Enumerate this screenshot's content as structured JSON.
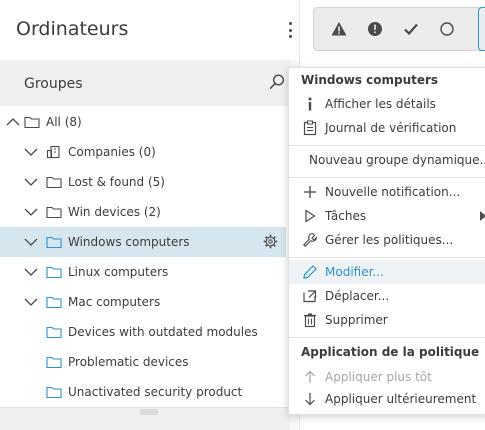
{
  "header": {
    "title": "Ordinateurs"
  },
  "groups": {
    "label": "Groupes",
    "tree": [
      {
        "label": "All (8)",
        "icon": "folder-icon"
      },
      {
        "label": "Companies (0)",
        "icon": "company-icon"
      },
      {
        "label": "Lost & found (5)",
        "icon": "folder-icon"
      },
      {
        "label": "Win devices (2)",
        "icon": "folder-icon"
      },
      {
        "label": "Windows computers",
        "icon": "folder-icon"
      },
      {
        "label": "Linux computers",
        "icon": "folder-icon"
      },
      {
        "label": "Mac computers",
        "icon": "folder-icon"
      },
      {
        "label": "Devices with outdated modules",
        "icon": "dynamic-folder-icon"
      },
      {
        "label": "Problematic devices",
        "icon": "dynamic-folder-icon"
      },
      {
        "label": "Unactivated security product",
        "icon": "dynamic-folder-icon"
      }
    ]
  },
  "status_filters": [
    "warning-icon",
    "error-icon",
    "ok-icon",
    "none-icon"
  ],
  "context_menu": {
    "heading": "Windows computers",
    "items": [
      {
        "label": "Afficher les détails",
        "icon": "info-icon"
      },
      {
        "label": "Journal de vérification",
        "icon": "audit-log-icon"
      },
      {
        "label": "Nouveau groupe dynamique...",
        "icon": "plus-icon"
      },
      {
        "label": "Nouvelle notification...",
        "icon": "plus-icon"
      },
      {
        "label": "Tâches",
        "icon": "play-icon"
      },
      {
        "label": "Gérer les politiques...",
        "icon": "wrench-icon"
      },
      {
        "label": "Modifier...",
        "icon": "pencil-icon"
      },
      {
        "label": "Déplacer...",
        "icon": "move-icon"
      },
      {
        "label": "Supprimer",
        "icon": "trash-icon"
      }
    ],
    "policy_heading": "Application de la politique",
    "policy_items": [
      {
        "label": "Appliquer plus tôt",
        "icon": "arrow-up-icon"
      },
      {
        "label": "Appliquer ultérieurement",
        "icon": "arrow-down-icon"
      }
    ]
  },
  "colors": {
    "accent": "#2d93c9",
    "selected_row": "#d6e6ee",
    "header_bg": "#f0f0f0"
  }
}
